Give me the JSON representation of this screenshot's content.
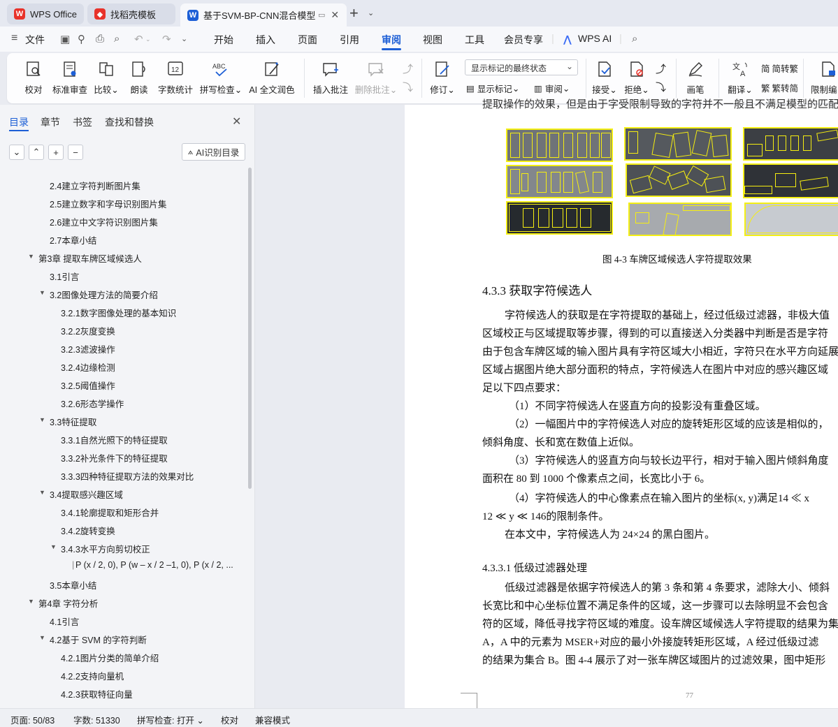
{
  "titlebar": {
    "tabs": [
      {
        "label": "WPS Office",
        "logo": "S",
        "logo_color": "#e8322a"
      },
      {
        "label": "找稻壳模板",
        "logo": "D",
        "logo_color": "#e8322a"
      },
      {
        "label": "基于SVM-BP-CNN混合模型",
        "logo": "W",
        "logo_color": "#1d5fd6"
      }
    ]
  },
  "menubar": {
    "file": "文件",
    "items": [
      "开始",
      "插入",
      "页面",
      "引用",
      "审阅",
      "视图",
      "工具",
      "会员专享"
    ],
    "active": "审阅",
    "wps_ai": "WPS AI"
  },
  "ribbon": {
    "proofread": "校对",
    "standard_review": "标准审查",
    "compare": "比较",
    "read_aloud": "朗读",
    "word_count": "字数统计",
    "spell_check": "拼写检查",
    "ai_polish": "AI 全文润色",
    "insert_comment": "插入批注",
    "delete_comment": "删除批注",
    "markup_select": "显示标记的最终状态",
    "track_changes": "修订",
    "show_markup": "显示标记",
    "review": "审阅",
    "accept": "接受",
    "reject": "拒绝",
    "pen": "画笔",
    "translate": "翻译",
    "to_traditional": "简转繁",
    "to_simplified": "繁转简",
    "restrict_edit": "限制编"
  },
  "leftpanel": {
    "tabs": [
      "目录",
      "章节",
      "书签",
      "查找和替换"
    ],
    "ai_button": "AI识别目录",
    "toc": [
      {
        "text": "2.4建立字符判断图片集",
        "level": 2,
        "arrow": ""
      },
      {
        "text": "2.5建立数字和字母识别图片集",
        "level": 2,
        "arrow": ""
      },
      {
        "text": "2.6建立中文字符识别图片集",
        "level": 2,
        "arrow": ""
      },
      {
        "text": "2.7本章小结",
        "level": 2,
        "arrow": ""
      },
      {
        "text": "第3章 提取车牌区域候选人",
        "level": 1,
        "arrow": "▼"
      },
      {
        "text": "3.1引言",
        "level": 2,
        "arrow": ""
      },
      {
        "text": "3.2图像处理方法的简要介绍",
        "level": 2,
        "arrow": "▼"
      },
      {
        "text": "3.2.1数字图像处理的基本知识",
        "level": 3,
        "arrow": ""
      },
      {
        "text": "3.2.2灰度变换",
        "level": 3,
        "arrow": ""
      },
      {
        "text": "3.2.3滤波操作",
        "level": 3,
        "arrow": ""
      },
      {
        "text": "3.2.4边缘检测",
        "level": 3,
        "arrow": ""
      },
      {
        "text": "3.2.5阈值操作",
        "level": 3,
        "arrow": ""
      },
      {
        "text": "3.2.6形态学操作",
        "level": 3,
        "arrow": ""
      },
      {
        "text": "3.3特征提取",
        "level": 2,
        "arrow": "▼"
      },
      {
        "text": "3.3.1自然光照下的特征提取",
        "level": 3,
        "arrow": ""
      },
      {
        "text": "3.3.2补光条件下的特征提取",
        "level": 3,
        "arrow": ""
      },
      {
        "text": "3.3.3四种特征提取方法的效果对比",
        "level": 3,
        "arrow": ""
      },
      {
        "text": "3.4提取感兴趣区域",
        "level": 2,
        "arrow": "▼"
      },
      {
        "text": "3.4.1轮廓提取和矩形合并",
        "level": 3,
        "arrow": ""
      },
      {
        "text": "3.4.2旋转变换",
        "level": 3,
        "arrow": ""
      },
      {
        "text": "3.4.3水平方向剪切校正",
        "level": 3,
        "arrow": "▼"
      },
      {
        "text": "P (x / 2, 0), P (w – x / 2 –1, 0), P (x / 2, ...",
        "level": 4,
        "arrow": ""
      },
      {
        "text": "3.5本章小结",
        "level": 2,
        "arrow": ""
      },
      {
        "text": "第4章 字符分析",
        "level": 1,
        "arrow": "▼"
      },
      {
        "text": "4.1引言",
        "level": 2,
        "arrow": ""
      },
      {
        "text": "4.2基于 SVM 的字符判断",
        "level": 2,
        "arrow": "▼"
      },
      {
        "text": "4.2.1图片分类的简单介绍",
        "level": 3,
        "arrow": ""
      },
      {
        "text": "4.2.2支持向量机",
        "level": 3,
        "arrow": ""
      },
      {
        "text": "4.2.3获取特征向量",
        "level": 3,
        "arrow": ""
      },
      {
        "text": "4.2.4字符判断模型的训练与测试",
        "level": 3,
        "arrow": ""
      }
    ]
  },
  "document": {
    "top_cut": "提取操作的效果，但是由于字受限制导致的字符并不一般且不满足模型的匹配。",
    "figure_caption": "图 4-3 车牌区域候选人字符提取效果",
    "heading": "4.3.3 获取字符候选人",
    "lines": [
      "字符候选人的获取是在字符提取的基础上，经过低级过滤器，非极大值",
      "区域校正与区域提取等步骤，得到的可以直接送入分类器中判断是否是字符",
      "由于包含车牌区域的输入图片具有字符区域大小相近，字符只在水平方向延展",
      "区域占据图片绝大部分面积的特点，字符候选人在图片中对应的感兴趣区域",
      "足以下四点要求：",
      "（1）不同字符候选人在竖直方向的投影没有重叠区域。",
      "（2）一幅图片中的字符候选人对应的旋转矩形区域的应该是相似的，",
      "倾斜角度、长和宽在数值上近似。",
      "（3）字符候选人的竖直方向与较长边平行，相对于输入图片倾斜角度",
      "面积在  80 到 1000 个像素点之间，长宽比小于   6。",
      "（4）字符候选人的中心像素点在输入图片的坐标(x, y)满足14 ≪ x",
      "12 ≪ y ≪ 146的限制条件。",
      "在本文中，字符候选人为  24×24 的黑白图片。"
    ],
    "subheading": "4.3.3.1  低级过滤器处理",
    "lines2": [
      "低级过滤器是依据字符候选人的第  3 条和第  4 条要求，滤除大小、倾斜",
      "长宽比和中心坐标位置不满足条件的区域，这一步骤可以去除明显不会包含",
      "符的区域，降低寻找字符区域的难度。设车牌区域候选人字符提取的结果为集",
      "A，A 中的元素为  MSER+对应的最小外接旋转矩形区域，A 经过低级过滤",
      "的结果为集合  B。图 4-4 展示了对一张车牌区域图片的过滤效果，图中矩形"
    ],
    "page_number": "77"
  },
  "statusbar": {
    "page": "页面: 50/83",
    "words": "字数: 51330",
    "spell": "拼写检查: 打开",
    "proof": "校对",
    "compat": "兼容模式"
  },
  "colors": {
    "accent": "#1d5fd6",
    "highlight": "#f4ef14",
    "wps_red": "#e8322a"
  }
}
